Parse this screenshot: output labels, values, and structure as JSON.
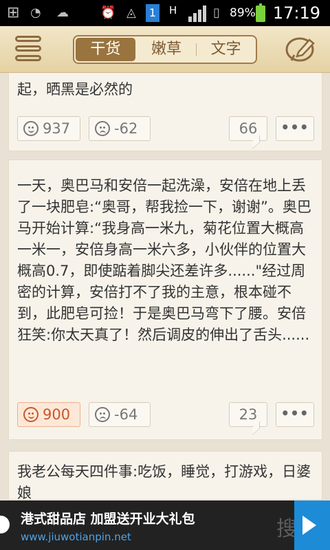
{
  "status_bar": {
    "battery_percent": "89%",
    "time": "17:19",
    "network_type": "H",
    "sim_badge": "1"
  },
  "header": {
    "tabs": [
      {
        "label": "干货",
        "active": true
      },
      {
        "label": "嫩草",
        "active": false
      },
      {
        "label": "文字",
        "active": false
      }
    ]
  },
  "feed": {
    "posts": [
      {
        "text": "起，晒黑是必然的",
        "up_count": "937",
        "down_count": "-62",
        "comment_count": "66",
        "more_label": "•••"
      },
      {
        "text": "一天，奥巴马和安倍一起洗澡，安倍在地上丢了一块肥皂:“奥哥，帮我捡一下，谢谢”。奥巴马开始计算:“我身高一米九，菊花位置大概高一米一，安倍身高一米六多，小伙伴的位置大概高0.7，即使踮着脚尖还差许多......\"经过周密的计算，安倍打不了我的主意，根本碰不到，此肥皂可捡！于是奥巴马弯下了腰。安倍狂笑:你太天真了！然后调皮的伸出了舌头......",
        "up_count": "900",
        "down_count": "-64",
        "comment_count": "23",
        "more_label": "•••"
      },
      {
        "text": "我老公每天四件事:吃饭，睡觉，打游戏，日婆娘"
      }
    ]
  },
  "ad": {
    "title": "港式甜品店 加盟送开业大礼包",
    "url": "www.jiuwotianpin.net",
    "brand": "搜豹"
  },
  "colors": {
    "header_bg": "#e9d8ad",
    "active_tab": "#99743e",
    "hot_like": "#c8562a"
  }
}
